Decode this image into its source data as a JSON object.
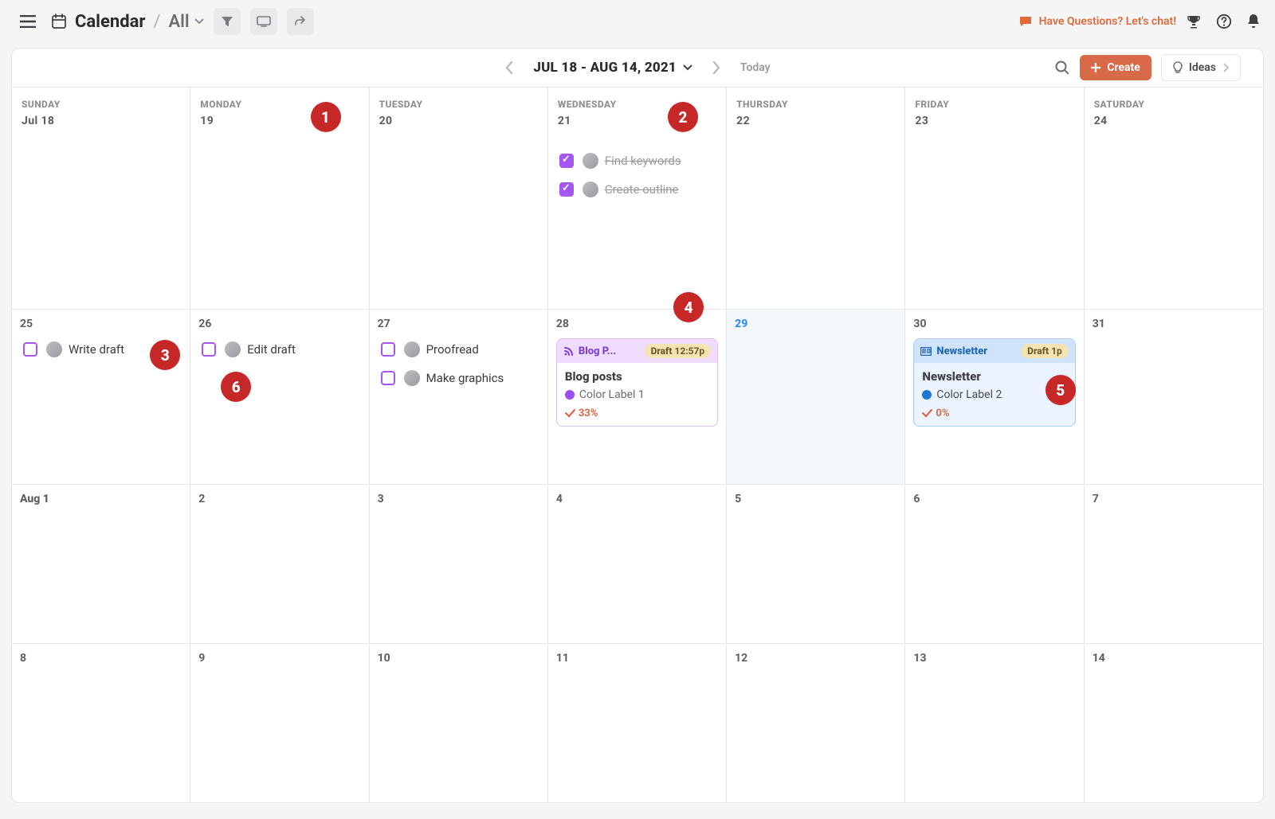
{
  "topbar": {
    "breadcrumb_title": "Calendar",
    "breadcrumb_view": "All",
    "chat_text": "Have Questions? Let's chat!"
  },
  "header": {
    "range": "JUL 18 - AUG 14, 2021",
    "today": "Today",
    "create": "Create",
    "ideas": "Ideas"
  },
  "dayNames": [
    "SUNDAY",
    "MONDAY",
    "TUESDAY",
    "WEDNESDAY",
    "THURSDAY",
    "FRIDAY",
    "SATURDAY"
  ],
  "week1_dates": [
    "Jul 18",
    "19",
    "20",
    "21",
    "22",
    "23",
    "24"
  ],
  "week2_dates": [
    "25",
    "26",
    "27",
    "28",
    "29",
    "30",
    "31"
  ],
  "week3_dates": [
    "Aug 1",
    "2",
    "3",
    "4",
    "5",
    "6",
    "7"
  ],
  "week4_dates": [
    "8",
    "9",
    "10",
    "11",
    "12",
    "13",
    "14"
  ],
  "tasks": {
    "w1_wed_1": "Find keywords",
    "w1_wed_2": "Create outline",
    "w2_sun_1": "Write draft",
    "w2_mon_1": "Edit draft",
    "w2_tue_1": "Proofread",
    "w2_tue_2": "Make graphics"
  },
  "cards": {
    "blog": {
      "head": "Blog P...",
      "pill_status": "Draft",
      "pill_time": "12:57p",
      "title": "Blog posts",
      "label": "Color Label 1",
      "progress": "33%"
    },
    "newsletter": {
      "head": "Newsletter",
      "pill_status": "Draft",
      "pill_time": "1p",
      "title": "Newsletter",
      "label": "Color Label 2",
      "progress": "0%"
    }
  },
  "badges": {
    "b1": "1",
    "b2": "2",
    "b3": "3",
    "b4": "4",
    "b5": "5",
    "b6": "6"
  }
}
